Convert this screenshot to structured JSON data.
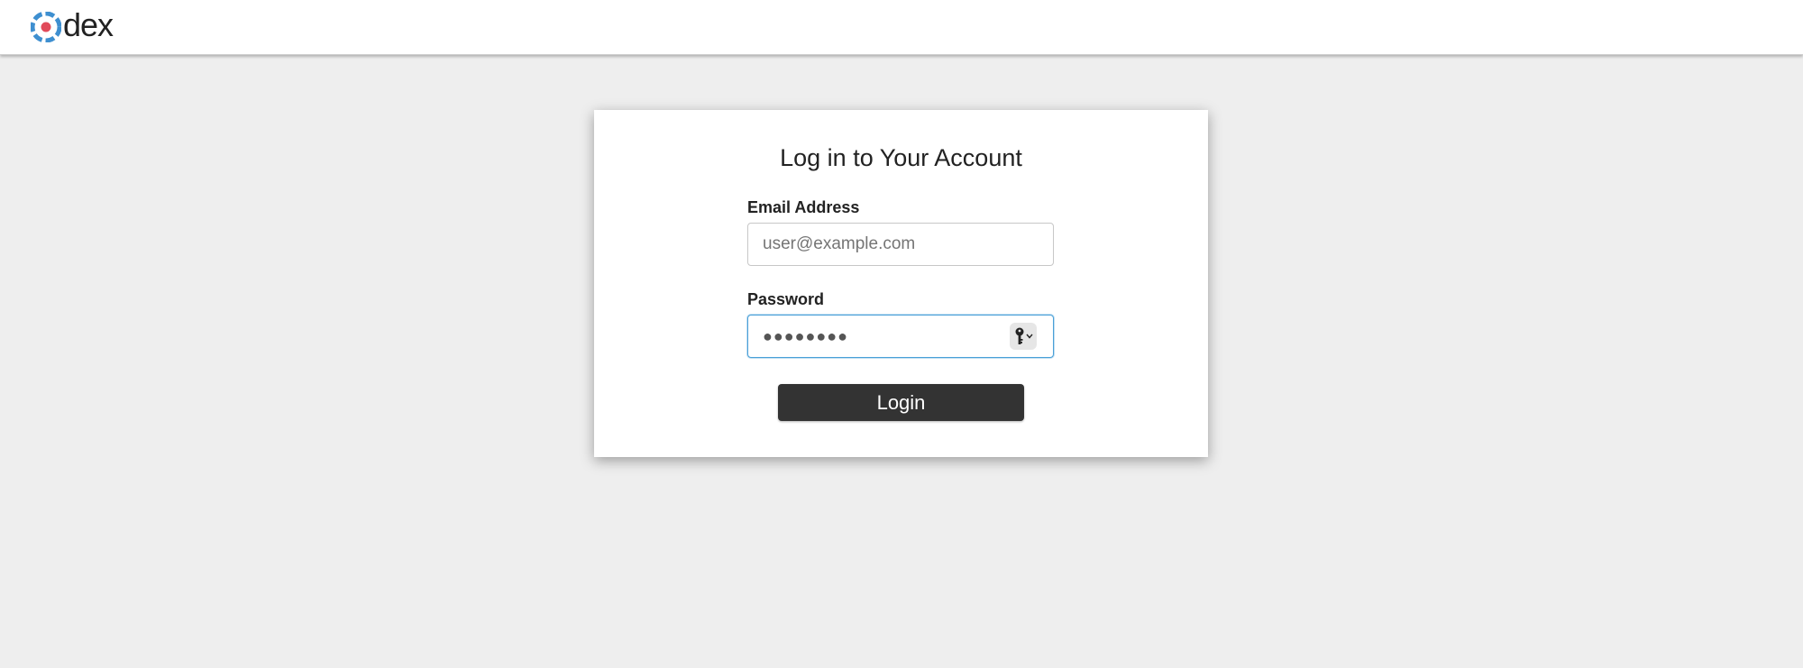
{
  "header": {
    "brand": "dex",
    "logo_icon": "dex-logo-icon",
    "brand_colors": [
      "#3e8fd0",
      "#e14a5a"
    ]
  },
  "card": {
    "title": "Log in to Your Account",
    "email": {
      "label": "Email Address",
      "placeholder": "user@example.com",
      "value": ""
    },
    "password": {
      "label": "Password",
      "masked_value": "●●●●●●●●",
      "autofill_icon": "key-icon"
    },
    "login_button": {
      "label": "Login",
      "color": "#333333"
    }
  },
  "colors": {
    "page_background": "#eeeeee",
    "card_background": "#ffffff",
    "focus_border": "#4aa0d8"
  }
}
